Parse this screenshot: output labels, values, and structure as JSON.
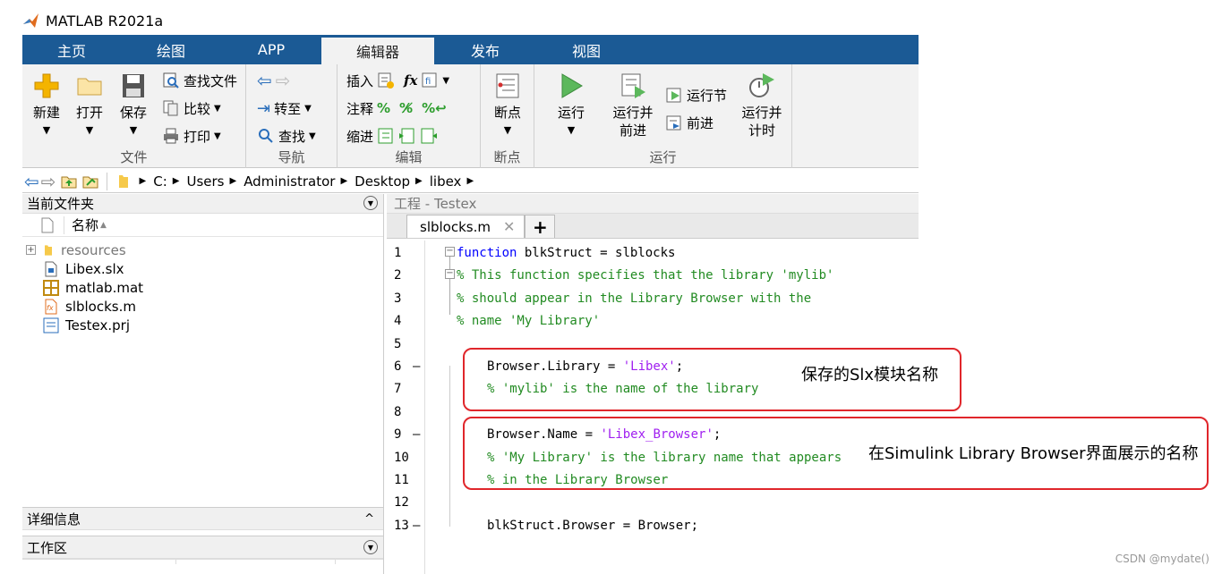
{
  "app": {
    "title": "MATLAB R2021a"
  },
  "tabs": [
    {
      "label": "主页"
    },
    {
      "label": "绘图"
    },
    {
      "label": "APP"
    },
    {
      "label": "编辑器"
    },
    {
      "label": "发布"
    },
    {
      "label": "视图"
    }
  ],
  "ribbon": {
    "file": {
      "title": "文件",
      "new": "新建",
      "open": "打开",
      "save": "保存",
      "find_files": "查找文件",
      "compare": "比较",
      "print": "打印"
    },
    "nav": {
      "title": "导航",
      "goto": "转至",
      "find": "查找"
    },
    "edit": {
      "title": "编辑",
      "insert": "插入",
      "comment": "注释",
      "indent": "缩进",
      "fx": "fx"
    },
    "breakpoints": {
      "title": "断点",
      "label": "断点"
    },
    "run": {
      "title": "运行",
      "run": "运行",
      "run_advance_1": "运行并",
      "run_advance_2": "前进",
      "run_section": "运行节",
      "advance": "前进",
      "run_time_1": "运行并",
      "run_time_2": "计时"
    }
  },
  "path": [
    "C:",
    "Users",
    "Administrator",
    "Desktop",
    "libex"
  ],
  "current_folder": {
    "title": "当前文件夹",
    "col_name": "名称",
    "files": [
      {
        "name": "resources"
      },
      {
        "name": "Libex.slx"
      },
      {
        "name": "matlab.mat"
      },
      {
        "name": "slblocks.m"
      },
      {
        "name": "Testex.prj"
      }
    ],
    "details": "详细信息",
    "workspace": "工作区"
  },
  "project": {
    "title": "工程 - Testex"
  },
  "editor": {
    "tab": "slblocks.m",
    "plus": "+",
    "lines": [
      {
        "n": "1",
        "dash": "",
        "parts": [
          {
            "t": "function",
            "c": "kw"
          },
          {
            "t": " blkStruct = slblocks",
            "c": ""
          }
        ]
      },
      {
        "n": "2",
        "dash": "",
        "parts": [
          {
            "t": "% This function specifies that the library 'mylib'",
            "c": "cm"
          }
        ]
      },
      {
        "n": "3",
        "dash": "",
        "parts": [
          {
            "t": "% should appear in the Library Browser with the",
            "c": "cm"
          }
        ]
      },
      {
        "n": "4",
        "dash": "",
        "parts": [
          {
            "t": "% name 'My Library'",
            "c": "cm"
          }
        ]
      },
      {
        "n": "5",
        "dash": "",
        "parts": []
      },
      {
        "n": "6",
        "dash": "—",
        "parts": [
          {
            "t": "Browser.Library = ",
            "c": ""
          },
          {
            "t": "'Libex'",
            "c": "st"
          },
          {
            "t": ";",
            "c": ""
          }
        ]
      },
      {
        "n": "7",
        "dash": "",
        "parts": [
          {
            "t": "% 'mylib' is the name of the library",
            "c": "cm"
          }
        ]
      },
      {
        "n": "8",
        "dash": "",
        "parts": []
      },
      {
        "n": "9",
        "dash": "—",
        "parts": [
          {
            "t": "Browser.Name = ",
            "c": ""
          },
          {
            "t": "'Libex_Browser'",
            "c": "st"
          },
          {
            "t": ";",
            "c": ""
          }
        ]
      },
      {
        "n": "10",
        "dash": "",
        "parts": [
          {
            "t": "% 'My Library' is the library name that appears",
            "c": "cm"
          }
        ]
      },
      {
        "n": "11",
        "dash": "",
        "parts": [
          {
            "t": "% in the Library Browser",
            "c": "cm"
          }
        ]
      },
      {
        "n": "12",
        "dash": "",
        "parts": []
      },
      {
        "n": "13",
        "dash": "—",
        "parts": [
          {
            "t": "blkStruct.Browser = Browser;",
            "c": ""
          }
        ]
      }
    ]
  },
  "annotations": {
    "note1": "保存的Slx模块名称",
    "note2": "在Simulink Library Browser界面展示的名称"
  },
  "watermark": "CSDN @mydate()",
  "colors": {
    "tab_bar": "#1b5a95",
    "comment": "#228b22",
    "keyword": "#0000ff",
    "string": "#a020f0",
    "callout": "#e0262b"
  }
}
